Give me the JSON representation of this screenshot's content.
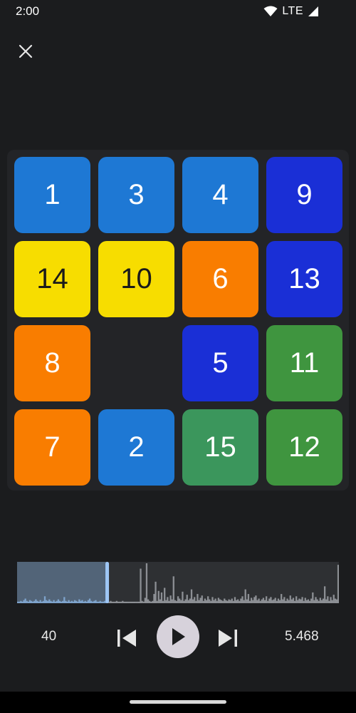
{
  "status_bar": {
    "time": "2:00",
    "network_label": "LTE",
    "icons": [
      "wifi-icon",
      "signal-icon"
    ]
  },
  "toolbar": {
    "close_icon": "close-icon"
  },
  "puzzle": {
    "grid": [
      [
        {
          "value": "1",
          "color": "#1e78d4"
        },
        {
          "value": "3",
          "color": "#1e78d4"
        },
        {
          "value": "4",
          "color": "#1e78d4"
        },
        {
          "value": "9",
          "color": "#1a2fd6"
        }
      ],
      [
        {
          "value": "14",
          "color": "#f7dd00"
        },
        {
          "value": "10",
          "color": "#f7dd00"
        },
        {
          "value": "6",
          "color": "#f97d00"
        },
        {
          "value": "13",
          "color": "#1a2fd6"
        }
      ],
      [
        {
          "value": "8",
          "color": "#f97d00"
        },
        null,
        {
          "value": "5",
          "color": "#1a2fd6"
        },
        {
          "value": "11",
          "color": "#3f953f"
        }
      ],
      [
        {
          "value": "7",
          "color": "#f97d00"
        },
        {
          "value": "2",
          "color": "#1e78d4"
        },
        {
          "value": "15",
          "color": "#3b965c"
        },
        {
          "value": "12",
          "color": "#3f953f"
        }
      ]
    ],
    "dark_text_color": "#1a1a1a",
    "light_text_color": "#ffffff"
  },
  "playback": {
    "moves": "40",
    "time": "5.468",
    "progress_fraction": 0.28,
    "accent_color": "#9ec6f5",
    "bar_color": "#8c8f94",
    "played_color": "#7fa3cc",
    "history": [
      2,
      2,
      3,
      2,
      4,
      6,
      3,
      2,
      4,
      3,
      2,
      3,
      5,
      3,
      2,
      4,
      2,
      3,
      9,
      4,
      3,
      5,
      3,
      2,
      4,
      2,
      3,
      5,
      3,
      2,
      3,
      8,
      3,
      2,
      4,
      2,
      3,
      2,
      4,
      3,
      2,
      5,
      3,
      4,
      2,
      3,
      2,
      4,
      6,
      3,
      2,
      3,
      4,
      2,
      2,
      3,
      2,
      2,
      3,
      2,
      2,
      2,
      3,
      2,
      2,
      2,
      3,
      2,
      2,
      2,
      3,
      2,
      2,
      2,
      2,
      2,
      2,
      2,
      2,
      2,
      2,
      2,
      45,
      3,
      2,
      7,
      52,
      5,
      3,
      2,
      3,
      12,
      28,
      3,
      16,
      5,
      14,
      3,
      20,
      4,
      8,
      3,
      10,
      5,
      35,
      4,
      3,
      9,
      6,
      4,
      15,
      3,
      5,
      11,
      4,
      6,
      18,
      5,
      8,
      3,
      12,
      4,
      7,
      10,
      3,
      6,
      4,
      9,
      5,
      3,
      8,
      4,
      6,
      3,
      7,
      5,
      4,
      3,
      6,
      4,
      3,
      5,
      4,
      6,
      3,
      8,
      4,
      5,
      3,
      6,
      9,
      4,
      18,
      5,
      12,
      3,
      7,
      4,
      8,
      10,
      4,
      6,
      3,
      5,
      7,
      4,
      9,
      3,
      6,
      8,
      4,
      5,
      7,
      3,
      6,
      4,
      12,
      5,
      8,
      3,
      6,
      4,
      10,
      5,
      7,
      3,
      9,
      4,
      6,
      5,
      8,
      3,
      7,
      4,
      5,
      3,
      6,
      14,
      4,
      8,
      5,
      3,
      7,
      4,
      6,
      22,
      5,
      9,
      3,
      8,
      4,
      11,
      6,
      5,
      50
    ]
  }
}
